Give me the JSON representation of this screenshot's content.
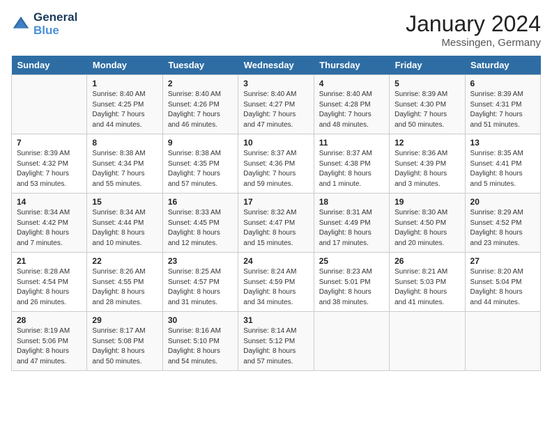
{
  "header": {
    "logo_line1": "General",
    "logo_line2": "Blue",
    "month": "January 2024",
    "location": "Messingen, Germany"
  },
  "weekdays": [
    "Sunday",
    "Monday",
    "Tuesday",
    "Wednesday",
    "Thursday",
    "Friday",
    "Saturday"
  ],
  "weeks": [
    [
      {
        "day": "",
        "sunrise": "",
        "sunset": "",
        "daylight": ""
      },
      {
        "day": "1",
        "sunrise": "Sunrise: 8:40 AM",
        "sunset": "Sunset: 4:25 PM",
        "daylight": "Daylight: 7 hours and 44 minutes."
      },
      {
        "day": "2",
        "sunrise": "Sunrise: 8:40 AM",
        "sunset": "Sunset: 4:26 PM",
        "daylight": "Daylight: 7 hours and 46 minutes."
      },
      {
        "day": "3",
        "sunrise": "Sunrise: 8:40 AM",
        "sunset": "Sunset: 4:27 PM",
        "daylight": "Daylight: 7 hours and 47 minutes."
      },
      {
        "day": "4",
        "sunrise": "Sunrise: 8:40 AM",
        "sunset": "Sunset: 4:28 PM",
        "daylight": "Daylight: 7 hours and 48 minutes."
      },
      {
        "day": "5",
        "sunrise": "Sunrise: 8:39 AM",
        "sunset": "Sunset: 4:30 PM",
        "daylight": "Daylight: 7 hours and 50 minutes."
      },
      {
        "day": "6",
        "sunrise": "Sunrise: 8:39 AM",
        "sunset": "Sunset: 4:31 PM",
        "daylight": "Daylight: 7 hours and 51 minutes."
      }
    ],
    [
      {
        "day": "7",
        "sunrise": "Sunrise: 8:39 AM",
        "sunset": "Sunset: 4:32 PM",
        "daylight": "Daylight: 7 hours and 53 minutes."
      },
      {
        "day": "8",
        "sunrise": "Sunrise: 8:38 AM",
        "sunset": "Sunset: 4:34 PM",
        "daylight": "Daylight: 7 hours and 55 minutes."
      },
      {
        "day": "9",
        "sunrise": "Sunrise: 8:38 AM",
        "sunset": "Sunset: 4:35 PM",
        "daylight": "Daylight: 7 hours and 57 minutes."
      },
      {
        "day": "10",
        "sunrise": "Sunrise: 8:37 AM",
        "sunset": "Sunset: 4:36 PM",
        "daylight": "Daylight: 7 hours and 59 minutes."
      },
      {
        "day": "11",
        "sunrise": "Sunrise: 8:37 AM",
        "sunset": "Sunset: 4:38 PM",
        "daylight": "Daylight: 8 hours and 1 minute."
      },
      {
        "day": "12",
        "sunrise": "Sunrise: 8:36 AM",
        "sunset": "Sunset: 4:39 PM",
        "daylight": "Daylight: 8 hours and 3 minutes."
      },
      {
        "day": "13",
        "sunrise": "Sunrise: 8:35 AM",
        "sunset": "Sunset: 4:41 PM",
        "daylight": "Daylight: 8 hours and 5 minutes."
      }
    ],
    [
      {
        "day": "14",
        "sunrise": "Sunrise: 8:34 AM",
        "sunset": "Sunset: 4:42 PM",
        "daylight": "Daylight: 8 hours and 7 minutes."
      },
      {
        "day": "15",
        "sunrise": "Sunrise: 8:34 AM",
        "sunset": "Sunset: 4:44 PM",
        "daylight": "Daylight: 8 hours and 10 minutes."
      },
      {
        "day": "16",
        "sunrise": "Sunrise: 8:33 AM",
        "sunset": "Sunset: 4:45 PM",
        "daylight": "Daylight: 8 hours and 12 minutes."
      },
      {
        "day": "17",
        "sunrise": "Sunrise: 8:32 AM",
        "sunset": "Sunset: 4:47 PM",
        "daylight": "Daylight: 8 hours and 15 minutes."
      },
      {
        "day": "18",
        "sunrise": "Sunrise: 8:31 AM",
        "sunset": "Sunset: 4:49 PM",
        "daylight": "Daylight: 8 hours and 17 minutes."
      },
      {
        "day": "19",
        "sunrise": "Sunrise: 8:30 AM",
        "sunset": "Sunset: 4:50 PM",
        "daylight": "Daylight: 8 hours and 20 minutes."
      },
      {
        "day": "20",
        "sunrise": "Sunrise: 8:29 AM",
        "sunset": "Sunset: 4:52 PM",
        "daylight": "Daylight: 8 hours and 23 minutes."
      }
    ],
    [
      {
        "day": "21",
        "sunrise": "Sunrise: 8:28 AM",
        "sunset": "Sunset: 4:54 PM",
        "daylight": "Daylight: 8 hours and 26 minutes."
      },
      {
        "day": "22",
        "sunrise": "Sunrise: 8:26 AM",
        "sunset": "Sunset: 4:55 PM",
        "daylight": "Daylight: 8 hours and 28 minutes."
      },
      {
        "day": "23",
        "sunrise": "Sunrise: 8:25 AM",
        "sunset": "Sunset: 4:57 PM",
        "daylight": "Daylight: 8 hours and 31 minutes."
      },
      {
        "day": "24",
        "sunrise": "Sunrise: 8:24 AM",
        "sunset": "Sunset: 4:59 PM",
        "daylight": "Daylight: 8 hours and 34 minutes."
      },
      {
        "day": "25",
        "sunrise": "Sunrise: 8:23 AM",
        "sunset": "Sunset: 5:01 PM",
        "daylight": "Daylight: 8 hours and 38 minutes."
      },
      {
        "day": "26",
        "sunrise": "Sunrise: 8:21 AM",
        "sunset": "Sunset: 5:03 PM",
        "daylight": "Daylight: 8 hours and 41 minutes."
      },
      {
        "day": "27",
        "sunrise": "Sunrise: 8:20 AM",
        "sunset": "Sunset: 5:04 PM",
        "daylight": "Daylight: 8 hours and 44 minutes."
      }
    ],
    [
      {
        "day": "28",
        "sunrise": "Sunrise: 8:19 AM",
        "sunset": "Sunset: 5:06 PM",
        "daylight": "Daylight: 8 hours and 47 minutes."
      },
      {
        "day": "29",
        "sunrise": "Sunrise: 8:17 AM",
        "sunset": "Sunset: 5:08 PM",
        "daylight": "Daylight: 8 hours and 50 minutes."
      },
      {
        "day": "30",
        "sunrise": "Sunrise: 8:16 AM",
        "sunset": "Sunset: 5:10 PM",
        "daylight": "Daylight: 8 hours and 54 minutes."
      },
      {
        "day": "31",
        "sunrise": "Sunrise: 8:14 AM",
        "sunset": "Sunset: 5:12 PM",
        "daylight": "Daylight: 8 hours and 57 minutes."
      },
      {
        "day": "",
        "sunrise": "",
        "sunset": "",
        "daylight": ""
      },
      {
        "day": "",
        "sunrise": "",
        "sunset": "",
        "daylight": ""
      },
      {
        "day": "",
        "sunrise": "",
        "sunset": "",
        "daylight": ""
      }
    ]
  ]
}
